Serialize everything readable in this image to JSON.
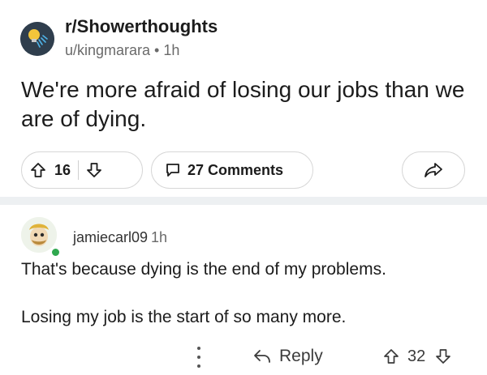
{
  "post": {
    "subreddit": "r/Showerthoughts",
    "author": "u/kingmarara",
    "separator": "•",
    "time": "1h",
    "title": "We're more afraid of losing our jobs than we are of dying.",
    "upvotes": "16",
    "comments_label": "27 Comments"
  },
  "comment": {
    "author": "jamiecarl09",
    "time": "1h",
    "line1": "That's because dying is the end of my problems.",
    "line2": "Losing my job is the start of so many more.",
    "reply_label": "Reply",
    "votes": "32"
  },
  "icons": {
    "subreddit_avatar": "lightbulb-shower-icon",
    "upvote": "arrow-up-outline-icon",
    "downvote": "arrow-down-outline-icon",
    "comments": "speech-bubble-icon",
    "share": "share-arrow-icon",
    "more": "vertical-dots-icon",
    "reply": "reply-arrow-icon"
  },
  "colors": {
    "online": "#2fa84f",
    "divider": "#edf0f2",
    "sub_avatar_bg": "#2f3e4d"
  }
}
